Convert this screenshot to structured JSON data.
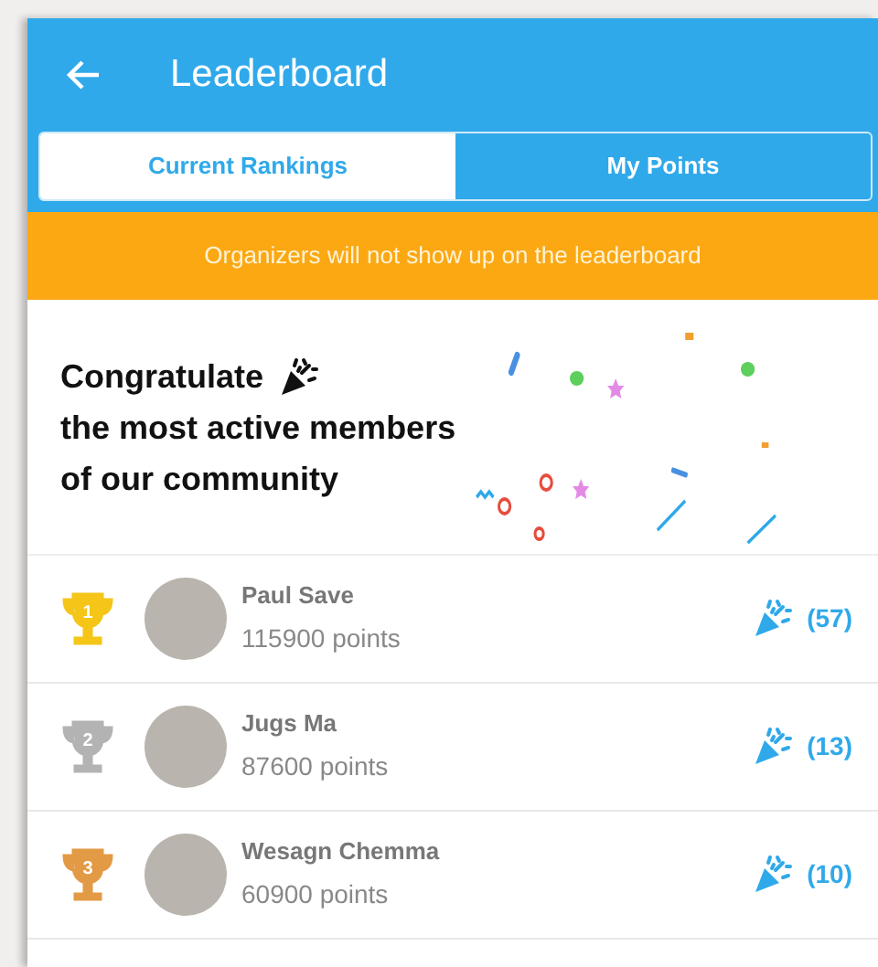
{
  "app_bar": {
    "title": "Leaderboard"
  },
  "tabs": [
    {
      "label": "Current Rankings",
      "selected": true
    },
    {
      "label": "My Points",
      "selected": false
    }
  ],
  "notice": "Organizers will not show up on the leaderboard",
  "congrats": {
    "title": "Congratulate",
    "lines": [
      "the most active members",
      "of our community"
    ]
  },
  "leaders": [
    {
      "rank": "1",
      "color": "#f5c518",
      "name": "Paul Save",
      "points": "115900 points",
      "cheers": "(57)"
    },
    {
      "rank": "2",
      "color": "#b3b3b3",
      "name": "Jugs Ma",
      "points": "87600 points",
      "cheers": "(13)"
    },
    {
      "rank": "3",
      "color": "#e39a45",
      "name": "Wesagn Chemma",
      "points": "60900 points",
      "cheers": "(10)"
    }
  ]
}
